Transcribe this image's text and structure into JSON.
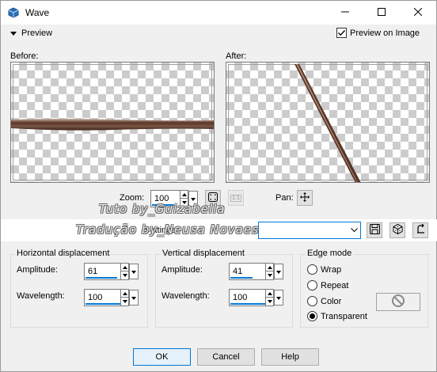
{
  "window": {
    "title": "Wave",
    "app_icon": "psp-icon",
    "controls": {
      "minimize_icon": "minimize-icon",
      "maximize_icon": "maximize-icon",
      "close_icon": "close-icon"
    }
  },
  "preview_section": {
    "toggle_label": "Preview",
    "preview_on_image_label": "Preview on Image",
    "preview_on_image_checked": true,
    "before_label": "Before:",
    "after_label": "After:"
  },
  "zoom": {
    "label": "Zoom:",
    "value": "100",
    "zoom_to_fit_icon": "zoom-fit-icon",
    "actual_size_icon": "actual-size-icon",
    "actual_size_text": "1:1"
  },
  "pan": {
    "label": "Pan:",
    "icon": "pan-move-icon"
  },
  "watermark": {
    "line1": "Tuto by_Guizabella",
    "line2": "Tradução by_Neusa Novaes"
  },
  "settings": {
    "label": "Settings",
    "value": "",
    "save_icon": "save-preset-icon",
    "randomize_icon": "randomize-icon",
    "reset_icon": "reset-icon"
  },
  "horizontal": {
    "title": "Horizontal displacement",
    "amplitude_label": "Amplitude:",
    "amplitude": "61",
    "wavelength_label": "Wavelength:",
    "wavelength": "100"
  },
  "vertical": {
    "title": "Vertical displacement",
    "amplitude_label": "Amplitude:",
    "amplitude": "41",
    "wavelength_label": "Wavelength:",
    "wavelength": "100"
  },
  "edge_mode": {
    "title": "Edge mode",
    "options": [
      "Wrap",
      "Repeat",
      "Color",
      "Transparent"
    ],
    "selected": "Transparent",
    "color_swatch_icon": "no-color-icon"
  },
  "buttons": {
    "ok": "OK",
    "cancel": "Cancel",
    "help": "Help"
  },
  "colors": {
    "accent": "#0078d7",
    "stroke_brown": "#6b4a3a"
  }
}
